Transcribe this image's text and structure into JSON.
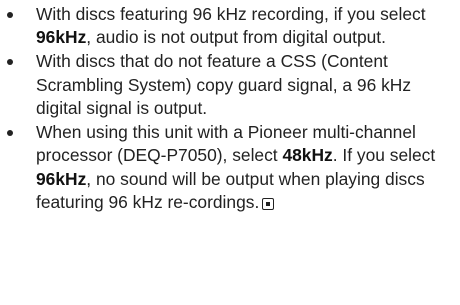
{
  "bullets": [
    {
      "parts": [
        {
          "text": "With discs featuring 96 kHz recording, if you select ",
          "bold": false
        },
        {
          "text": "96kHz",
          "bold": true
        },
        {
          "text": ", audio is not output from digital output.",
          "bold": false
        }
      ]
    },
    {
      "parts": [
        {
          "text": "With discs that do not feature a CSS (Content Scrambling System) copy guard signal, a 96 kHz digital signal is output.",
          "bold": false
        }
      ]
    },
    {
      "parts": [
        {
          "text": "When using this unit with a Pioneer multi-channel processor (DEQ-P7050), select ",
          "bold": false
        },
        {
          "text": "48kHz",
          "bold": true
        },
        {
          "text": ". If you select ",
          "bold": false
        },
        {
          "text": "96kHz",
          "bold": true
        },
        {
          "text": ", no sound will be output when playing discs featuring 96 kHz re-cordings.",
          "bold": false
        }
      ],
      "end_mark": "section-end-icon"
    }
  ]
}
